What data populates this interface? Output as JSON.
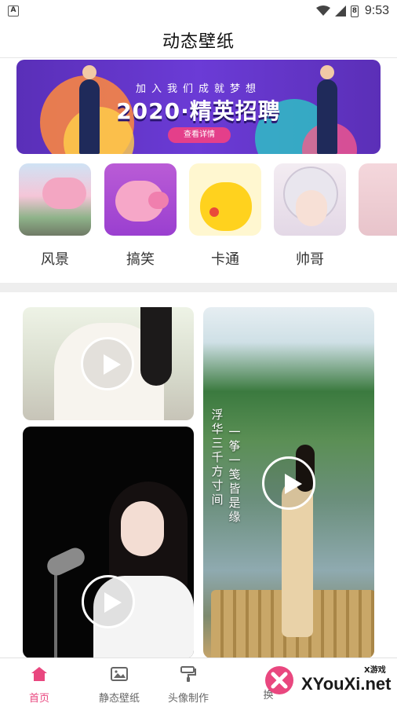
{
  "status_bar": {
    "left_icon": "A",
    "time": "9:53",
    "battery_glyph": "8"
  },
  "header": {
    "title": "动态壁纸"
  },
  "banner": {
    "subtitle": "加入我们成就梦想",
    "headline": "2020·精英招聘",
    "button": "查看详情"
  },
  "categories": [
    {
      "label": "风景",
      "icon": "scenery-thumbnail"
    },
    {
      "label": "搞笑",
      "icon": "funny-pig-thumbnail"
    },
    {
      "label": "卡通",
      "icon": "cartoon-pikachu-thumbnail"
    },
    {
      "label": "帅哥",
      "icon": "handsome-guy-thumbnail"
    }
  ],
  "videos": {
    "poem_line1": "浮华三千方寸间",
    "poem_line2": "一筝一笺皆是缘"
  },
  "bottom_nav": {
    "items": [
      {
        "label": "首页",
        "icon": "home-icon",
        "active": true
      },
      {
        "label": "静态壁纸",
        "icon": "image-icon",
        "active": false
      },
      {
        "label": "头像制作",
        "icon": "paint-roller-icon",
        "active": false
      },
      {
        "label": "换",
        "icon": "swap-icon",
        "active": false
      }
    ]
  },
  "watermark": {
    "brand": "XYouXi.net",
    "tag": "X游戏"
  },
  "colors": {
    "accent": "#e9477f",
    "banner_purple": "#5a2fb8"
  }
}
